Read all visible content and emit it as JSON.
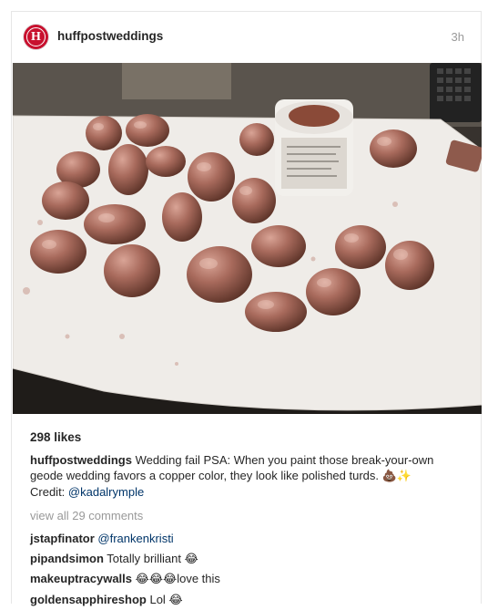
{
  "post": {
    "username": "huffpostweddings",
    "avatar_letter": "H",
    "time": "3h",
    "brand_color": "#c8102e"
  },
  "photo": {
    "description_icon": "photo-of-copper-painted-rocks",
    "jar_color": "#8a4a38"
  },
  "engagement": {
    "likes": "298 likes"
  },
  "caption": {
    "username": "huffpostweddings",
    "text": "Wedding fail PSA: When you paint those break-your-own geode wedding favors a copper color, they look like polished turds.",
    "emoji": "💩✨",
    "credit_prefix": "Credit: ",
    "credit_handle": "@kadalrymple"
  },
  "comments_link": "view all 29 comments",
  "comments": [
    {
      "user": "jstapfinator",
      "mention": "@frankenkristi",
      "text": "",
      "emoji": ""
    },
    {
      "user": "pipandsimon",
      "mention": "",
      "text": "Totally brilliant",
      "emoji": "😂"
    },
    {
      "user": "makeuptracywalls",
      "mention": "",
      "text": "love this",
      "emoji": "😂😂😂"
    },
    {
      "user": "goldensapphireshop",
      "mention": "",
      "text": "Lol",
      "emoji": "😂"
    }
  ]
}
